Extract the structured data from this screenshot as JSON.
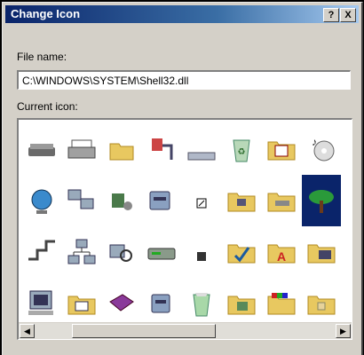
{
  "window": {
    "title": "Change Icon",
    "help_label": "?",
    "close_label": "X"
  },
  "filename": {
    "label": "File name:",
    "value": "C:\\WINDOWS\\SYSTEM\\Shell32.dll"
  },
  "icons": {
    "label": "Current icon:",
    "rows": [
      [
        "drive-icon",
        "printer-icon",
        "folder-open-icon",
        "network-cable-icon",
        "keyboard-icon",
        "recycle-bin-icon",
        "folder-calendar-icon",
        "audio-cd-icon"
      ],
      [
        "globe-icon",
        "network-computers-icon",
        "tools-icon",
        "cd-drive-icon",
        "shortcut-small-icon",
        "folder-network-icon",
        "folder-drive-icon",
        "tree-icon"
      ],
      [
        "network-wire-icon",
        "network-tree-icon",
        "find-computer-icon",
        "removable-drive-icon",
        "small-drive-icon",
        "folder-check-icon",
        "folder-fonts-icon",
        "folder-computer-icon"
      ],
      [
        "computer-icon",
        "folder-window-icon",
        "book-icon",
        "cd-drive-alt-icon",
        "recycle-bin-full-icon",
        "folder-tools-icon",
        "folder-color-icon",
        "folder-document-icon"
      ]
    ],
    "selected": "tree-icon"
  },
  "scrollbar": {
    "left_arrow": "◀",
    "right_arrow": "▶"
  },
  "colors": {
    "titlebar_start": "#0a246a",
    "titlebar_end": "#a6caf0",
    "dialog_bg": "#d4d0c8",
    "selection": "#0a246a"
  }
}
